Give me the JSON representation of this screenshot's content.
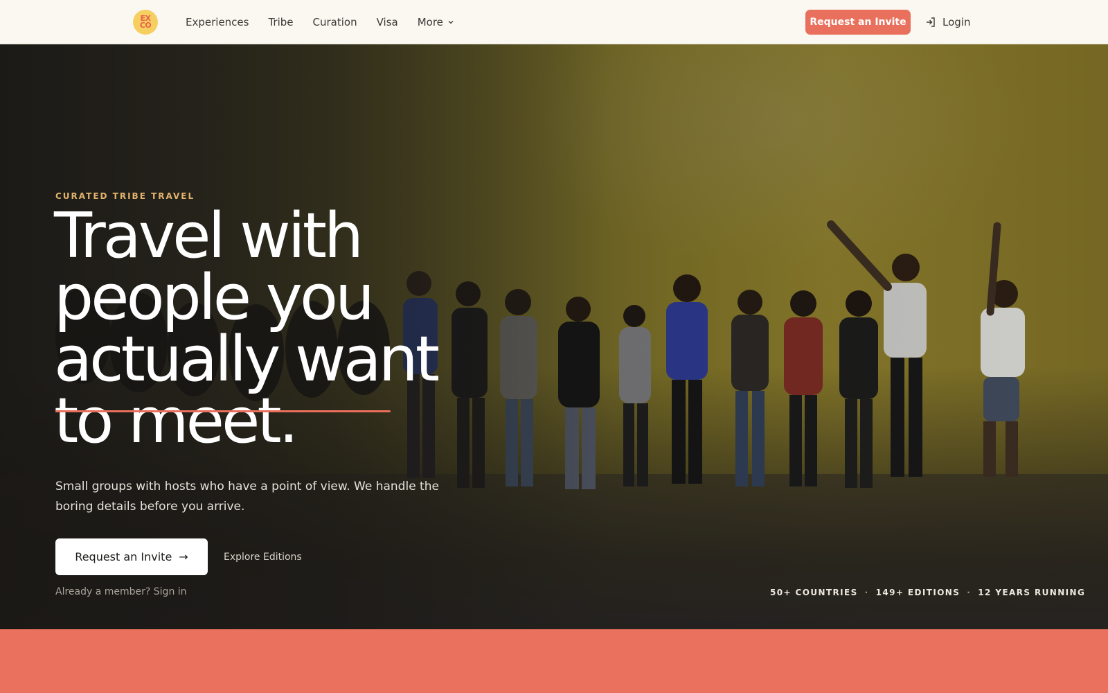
{
  "nav": {
    "logo_top": "EX",
    "logo_bottom": "CO",
    "links": [
      {
        "label": "Experiences"
      },
      {
        "label": "Tribe"
      },
      {
        "label": "Curation"
      },
      {
        "label": "Visa"
      },
      {
        "label": "More"
      }
    ],
    "cta_label": "Request an Invite",
    "login_label": "Login"
  },
  "hero": {
    "eyebrow": "CURATED TRIBE TRAVEL",
    "headline_lines": [
      "Travel with",
      "people you",
      "actually want",
      "to meet."
    ],
    "subtitle": "Small groups with hosts who have a point of view. We handle the boring details before you arrive.",
    "primary_cta": "Request an Invite",
    "primary_cta_arrow": "→",
    "secondary_cta": "Explore Editions",
    "signin_text": "Already a member? Sign in",
    "stats": [
      "50+ COUNTRIES",
      "149+ EDITIONS",
      "12 YEARS RUNNING"
    ],
    "stats_separator": "·"
  },
  "colors": {
    "accent": "#e9705c",
    "nav_bg": "#fbf8f2",
    "eyebrow": "#e2b36d",
    "logo_bg": "#f6cf61"
  },
  "icons": {
    "logo": "exco-logo",
    "more": "chevron-down-icon",
    "login": "sign-in-icon",
    "arrow": "arrow-right-icon"
  }
}
